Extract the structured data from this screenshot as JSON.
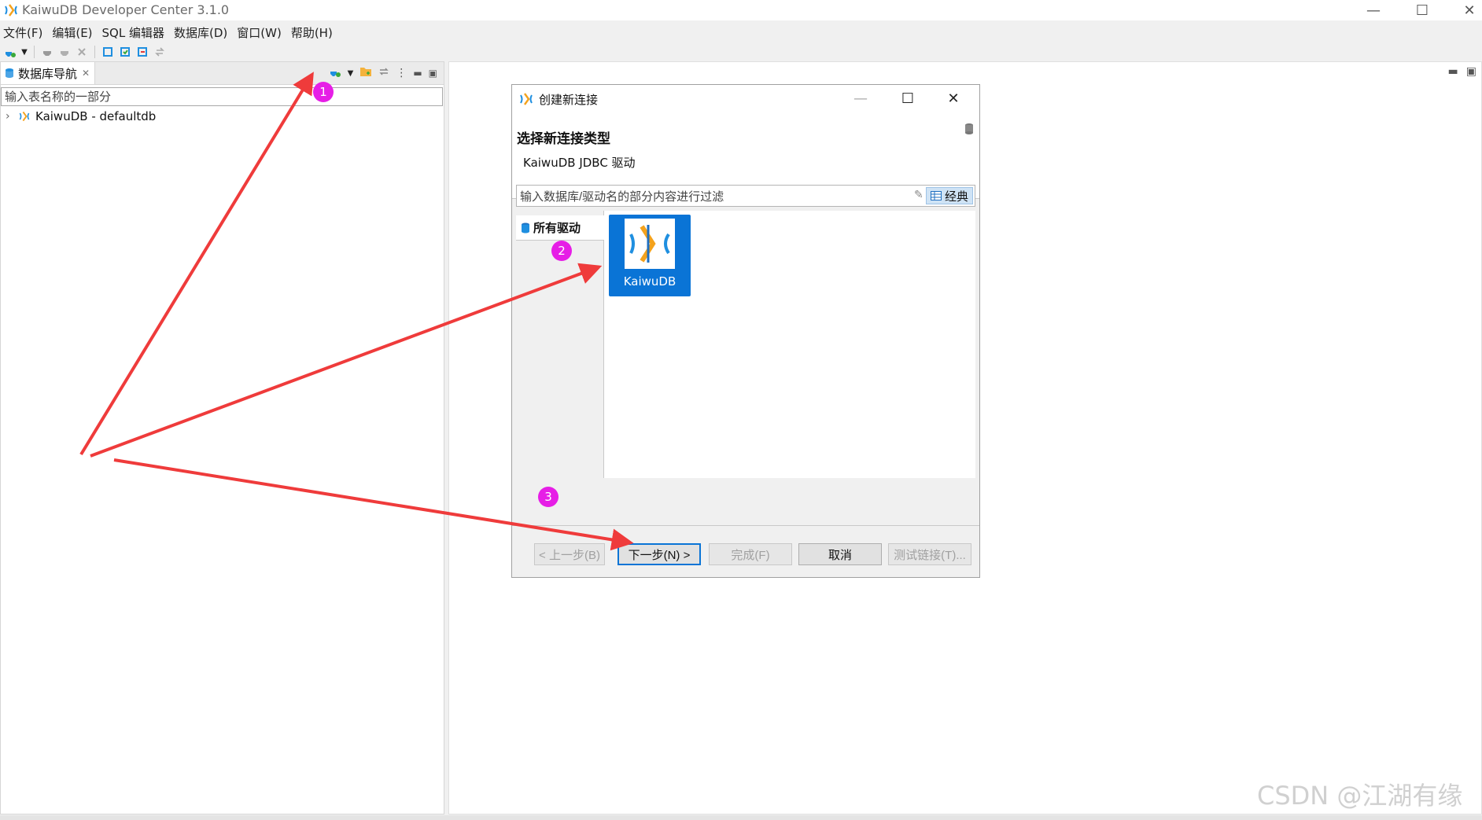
{
  "app": {
    "title": "KaiwuDB Developer Center 3.1.0",
    "icon": "kaiwudb-logo-icon"
  },
  "window_controls": [
    "minimize-icon",
    "maximize-icon",
    "close-icon"
  ],
  "menu": [
    "文件(F)",
    "编辑(E)",
    "SQL 编辑器",
    "数据库(D)",
    "窗口(W)",
    "帮助(H)"
  ],
  "navigator": {
    "tab_label": "数据库导航",
    "filter_placeholder": "输入表名称的一部分",
    "tree": [
      {
        "label": "KaiwuDB - defaultdb",
        "expanded": false
      }
    ]
  },
  "dialog": {
    "title": "创建新连接",
    "heading": "选择新连接类型",
    "subtitle": "KaiwuDB JDBC 驱动",
    "filter_placeholder": "输入数据库/驱动名的部分内容进行过滤",
    "classic_label": "经典",
    "category_tab": "所有驱动",
    "drivers": [
      {
        "name": "KaiwuDB",
        "selected": true
      }
    ],
    "buttons": {
      "back": "< 上一步(B)",
      "next": "下一步(N) >",
      "finish": "完成(F)",
      "cancel": "取消",
      "test": "测试链接(T)..."
    }
  },
  "annotations": {
    "badge_1": "1",
    "badge_2": "2",
    "badge_3": "3",
    "arrow_color": "#ef3b3b",
    "badge_color": "#e61ee6"
  },
  "watermark": "CSDN @江湖有缘",
  "colors": {
    "accent": "#0a74d6",
    "selected_tile": "#0a74d6",
    "classic_button": "#cfe3f5"
  }
}
